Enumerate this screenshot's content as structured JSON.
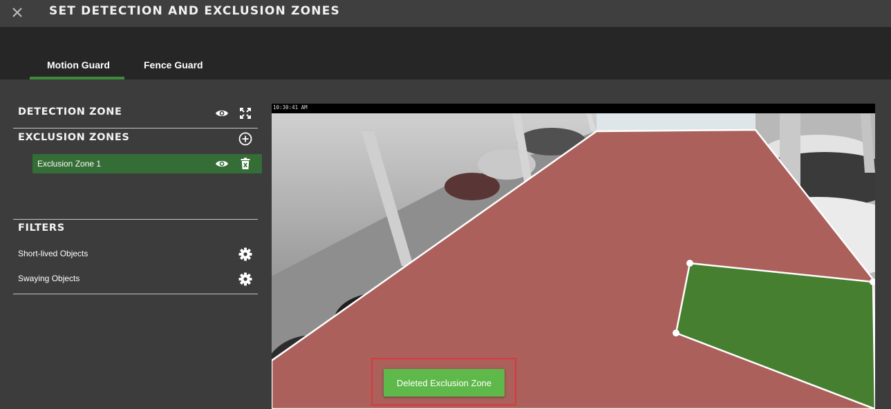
{
  "header": {
    "title": "SET DETECTION AND EXCLUSION ZONES",
    "close_icon": "close-icon"
  },
  "tabs": [
    {
      "label": "Motion Guard",
      "active": true
    },
    {
      "label": "Fence Guard",
      "active": false
    }
  ],
  "sidebar": {
    "detection_zone": {
      "title": "DETECTION ZONE",
      "icons": [
        "eye-icon",
        "expand-icon"
      ]
    },
    "exclusion_zones": {
      "title": "EXCLUSION ZONES",
      "add_icon": "plus-circle-icon",
      "items": [
        {
          "label": "Exclusion Zone 1",
          "icons": [
            "eye-icon",
            "trash-icon"
          ]
        }
      ]
    },
    "filters": {
      "title": "FILTERS",
      "items": [
        {
          "label": "Short-lived Objects",
          "icon": "gear-icon"
        },
        {
          "label": "Swaying Objects",
          "icon": "gear-icon"
        }
      ]
    }
  },
  "video": {
    "timestamp": "10:30:41 AM"
  },
  "toast": {
    "message": "Deleted Exclusion Zone"
  },
  "colors": {
    "accent_green": "#3d8b3a",
    "zone_row_green": "#356d37",
    "toast_green": "#5fb84a",
    "detection_zone_red": "#c0473f",
    "exclusion_zone_green": "#1f8a1f",
    "highlight_red": "#d9393d"
  }
}
